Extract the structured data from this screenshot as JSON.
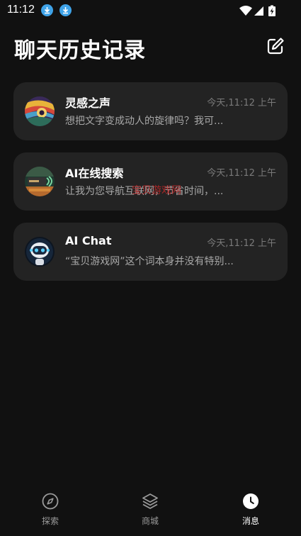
{
  "status": {
    "time": "11:12"
  },
  "header": {
    "title": "聊天历史记录",
    "edit_icon": "edit-icon"
  },
  "chats": [
    {
      "name": "灵感之声",
      "time": "今天,11:12 上午",
      "preview": "想把文字变成动人的旋律吗？我可..."
    },
    {
      "name": "AI在线搜索",
      "time": "今天,11:12 上午",
      "preview": "让我为您导航互联网，节省时间，..."
    },
    {
      "name": "AI Chat",
      "time": "今天,11:12 上午",
      "preview": "“宝贝游戏网”这个词本身并没有特别..."
    }
  ],
  "watermark": "宝贝游戏网",
  "nav": {
    "items": [
      {
        "label": "探索",
        "icon": "compass-icon"
      },
      {
        "label": "商城",
        "icon": "layers-icon"
      },
      {
        "label": "消息",
        "icon": "clock-icon",
        "active": true
      }
    ]
  }
}
